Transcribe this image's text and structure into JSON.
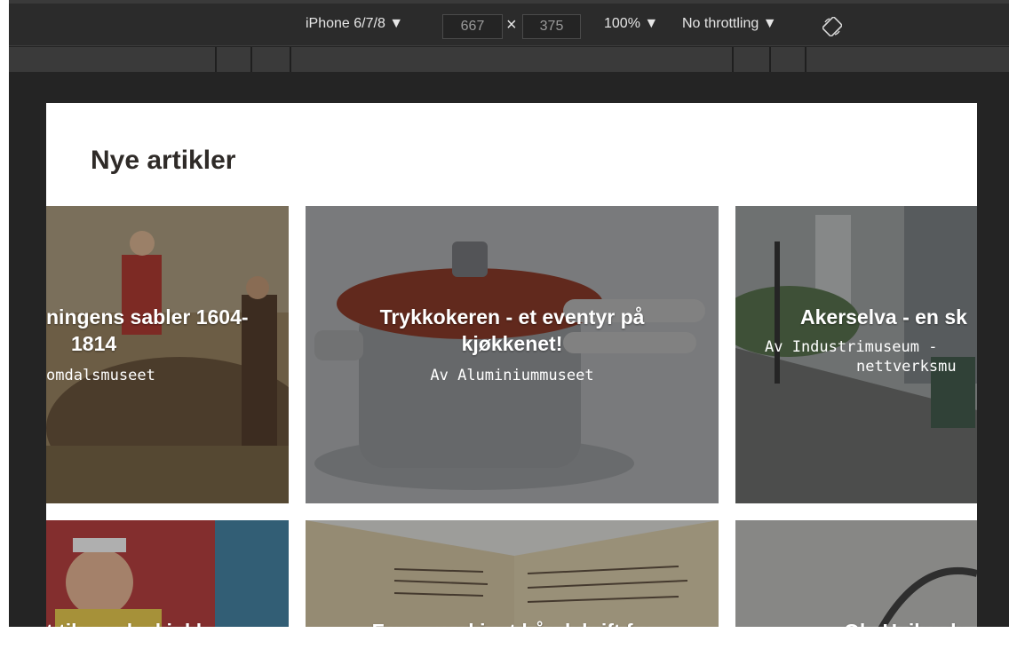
{
  "devtools": {
    "device": "iPhone 6/7/8 ▼",
    "width": "667",
    "times": "×",
    "height": "375",
    "zoom": "100% ▼",
    "throttling": "No throttling ▼",
    "rotate_icon": "rotate-icon"
  },
  "page": {
    "heading": "Nye artikler",
    "cards": [
      {
        "title_line1": "ningens sabler 1604-",
        "title_line2": "1814",
        "author": "omdalsmuseet"
      },
      {
        "title_line1": "Trykkokeren - et eventyr på",
        "title_line2": "kjøkkenet!",
        "author": "Av Aluminiummuseet"
      },
      {
        "title_line1": "Akerselva - en sk",
        "title_line2": "",
        "author_line1": "Av Industrimuseum -",
        "author_line2": "nettverksmu"
      },
      {
        "title_line1": "t til norske kjøkken",
        "title_line2": "",
        "author": ""
      },
      {
        "title_line1": "Funn av ukjent håndskrift fra",
        "title_line2": "",
        "author": ""
      },
      {
        "title_line1": "Ole Heilende",
        "title_line2": "",
        "author": ""
      }
    ]
  },
  "colors": {
    "devtools_bg": "#242424",
    "heading": "#2f2b28",
    "card_overlay": "#1e1e1e"
  }
}
